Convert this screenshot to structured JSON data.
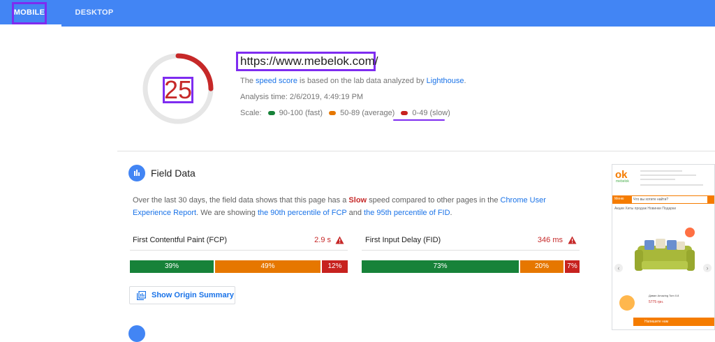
{
  "tabs": {
    "mobile": "MOBILE",
    "desktop": "DESKTOP"
  },
  "score": {
    "value": "25",
    "fraction": 0.25
  },
  "summary": {
    "url": "https://www.mebelok.com/",
    "desc_pre": "The ",
    "desc_link": "speed score",
    "desc_mid": " is based on the lab data analyzed by ",
    "desc_link2": "Lighthouse",
    "desc_post": ".",
    "analysis_time": "Analysis time: 2/6/2019, 4:49:19 PM",
    "scale_label": "Scale:",
    "scale_fast": "90-100 (fast)",
    "scale_average": "50-89 (average)",
    "scale_slow": "0-49 (slow)"
  },
  "field_data": {
    "title": "Field Data",
    "text_1": "Over the last 30 days, the field data shows that this page has a ",
    "slow_word": "Slow",
    "text_2": " speed compared to other pages in the ",
    "link_crux": "Chrome User Experience Report",
    "text_3": ". We are showing ",
    "link_fcp": "the 90th percentile of FCP",
    "text_4": " and ",
    "link_fid": "the 95th percentile of FID",
    "text_5": ".",
    "fcp": {
      "label": "First Contentful Paint (FCP)",
      "value": "2.9 s",
      "fast": "39%",
      "average": "49%",
      "slow": "12%",
      "fast_pct": 39,
      "average_pct": 49,
      "slow_pct": 12
    },
    "fid": {
      "label": "First Input Delay (FID)",
      "value": "346 ms",
      "fast": "73%",
      "average": "20%",
      "slow": "7%",
      "fast_pct": 73,
      "average_pct": 20,
      "slow_pct": 7
    },
    "origin_button": "Show Origin Summary"
  },
  "colors": {
    "fast": "#178239",
    "average": "#e67700",
    "slow": "#c7221f",
    "accent": "#4285f4",
    "highlight": "#7e2cf0"
  },
  "thumbnail": {
    "logo": "ok",
    "logo_sub": "mebelok",
    "menu": "Меню",
    "search": "Что вы хотите найти?",
    "tabs": "Акции   Хиты продаж   Новинки   Подарки",
    "caption": "Диван Amazing Tom 0.8",
    "price": "5775 грн.",
    "bottom": "Напишите нам"
  }
}
